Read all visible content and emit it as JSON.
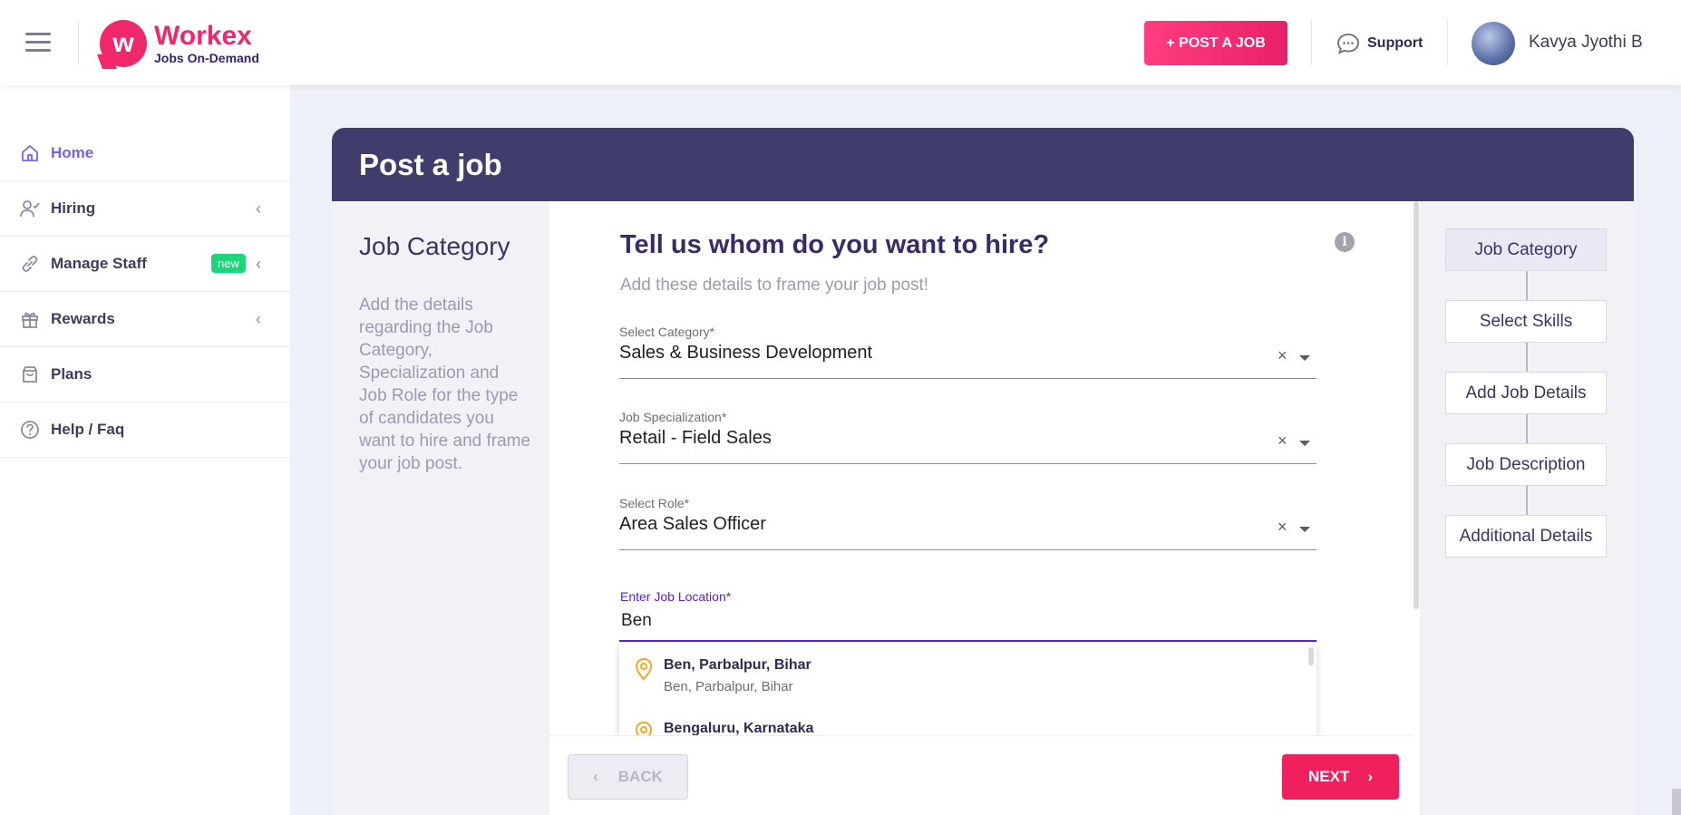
{
  "header": {
    "brand_name": "Workex",
    "brand_tagline": "Jobs On-Demand",
    "post_job_label": "+ POST A JOB",
    "support_label": "Support",
    "user_name": "Kavya Jyothi B"
  },
  "sidebar": {
    "items": [
      {
        "label": "Home",
        "icon": "home-icon",
        "active": true
      },
      {
        "label": "Hiring",
        "icon": "user-check-icon",
        "has_chevron": true
      },
      {
        "label": "Manage Staff",
        "icon": "link-icon",
        "badge": "new",
        "has_chevron": true
      },
      {
        "label": "Rewards",
        "icon": "gift-icon",
        "has_chevron": true
      },
      {
        "label": "Plans",
        "icon": "bag-icon"
      },
      {
        "label": "Help / Faq",
        "icon": "help-circle-icon"
      }
    ]
  },
  "card": {
    "title": "Post a job",
    "left_panel": {
      "title": "Job Category",
      "description": "Add the details regarding the Job Category, Specialization and Job Role for the type of candidates you want to hire and frame your job post."
    },
    "form": {
      "title": "Tell us whom do you want to hire?",
      "subtitle": "Add these details to frame your job post!",
      "fields": [
        {
          "label": "Select Category*",
          "value": "Sales & Business Development"
        },
        {
          "label": "Job Specialization*",
          "value": "Retail - Field Sales"
        },
        {
          "label": "Select Role*",
          "value": "Area Sales Officer"
        }
      ],
      "location": {
        "label": "Enter Job Location*",
        "value": "Ben"
      },
      "suggestions": [
        {
          "main": "Ben, Parbalpur, Bihar",
          "secondary": "Ben, Parbalpur, Bihar"
        },
        {
          "main": "Bengaluru, Karnataka",
          "secondary": ""
        }
      ],
      "clear_symbol": "×"
    },
    "footer": {
      "back_label": "BACK",
      "next_label": "NEXT"
    },
    "steps": [
      "Job Category",
      "Select Skills",
      "Add Job Details",
      "Job Description",
      "Additional Details"
    ]
  },
  "colors": {
    "brand_pink": "#f0276b",
    "header_navy": "#3e3d6c",
    "accent_purple": "#7b5cf0",
    "focus_purple": "#5b21d6",
    "badge_green": "#1bd67a",
    "next_red": "#f01f5e",
    "pin_orange": "#f5a623"
  }
}
